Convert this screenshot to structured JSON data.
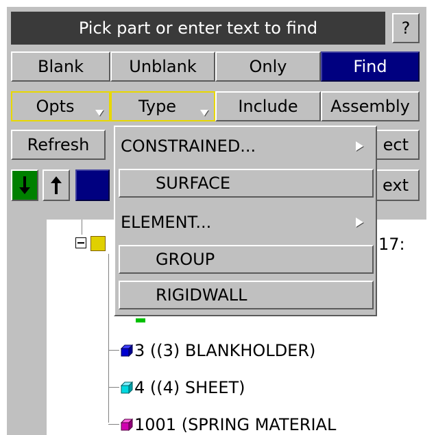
{
  "title": "Pick part or enter text to find",
  "help_label": "?",
  "row1": [
    "Blank",
    "Unblank",
    "Only",
    "Find"
  ],
  "row2": [
    "Opts",
    "Type",
    "Include",
    "Assembly"
  ],
  "row3": {
    "refresh": "Refresh",
    "select_partial": "ect"
  },
  "row4": {
    "next_partial": "ext"
  },
  "colors": {
    "panel": "#c0c0c0",
    "title_bg": "#3a3a3a",
    "active": "#000080",
    "down_arrow_bg": "#008000",
    "highlight": "#e8d800"
  },
  "icons": [
    "arrow-down-icon",
    "arrow-up-icon",
    "collapse-icon",
    "folder-icon",
    "cube-icon",
    "submenu-arrow-icon",
    "dropdown-triangle-icon"
  ],
  "tree": {
    "root_suffix": "17:",
    "items": [
      {
        "label": "3 ((3) BLANKHOLDER)",
        "color": "#0000d0"
      },
      {
        "label": "4 ((4) SHEET)",
        "color": "#00d8e0"
      },
      {
        "label": "1001 (SPRING MATERIAL",
        "color": "#d000b0"
      }
    ]
  },
  "menu": [
    {
      "label": "CONSTRAINED...",
      "submenu": true
    },
    {
      "label": "SURFACE",
      "submenu": false
    },
    {
      "label": "ELEMENT...",
      "submenu": true
    },
    {
      "label": "GROUP",
      "submenu": false
    },
    {
      "label": "RIGIDWALL",
      "submenu": false
    }
  ]
}
